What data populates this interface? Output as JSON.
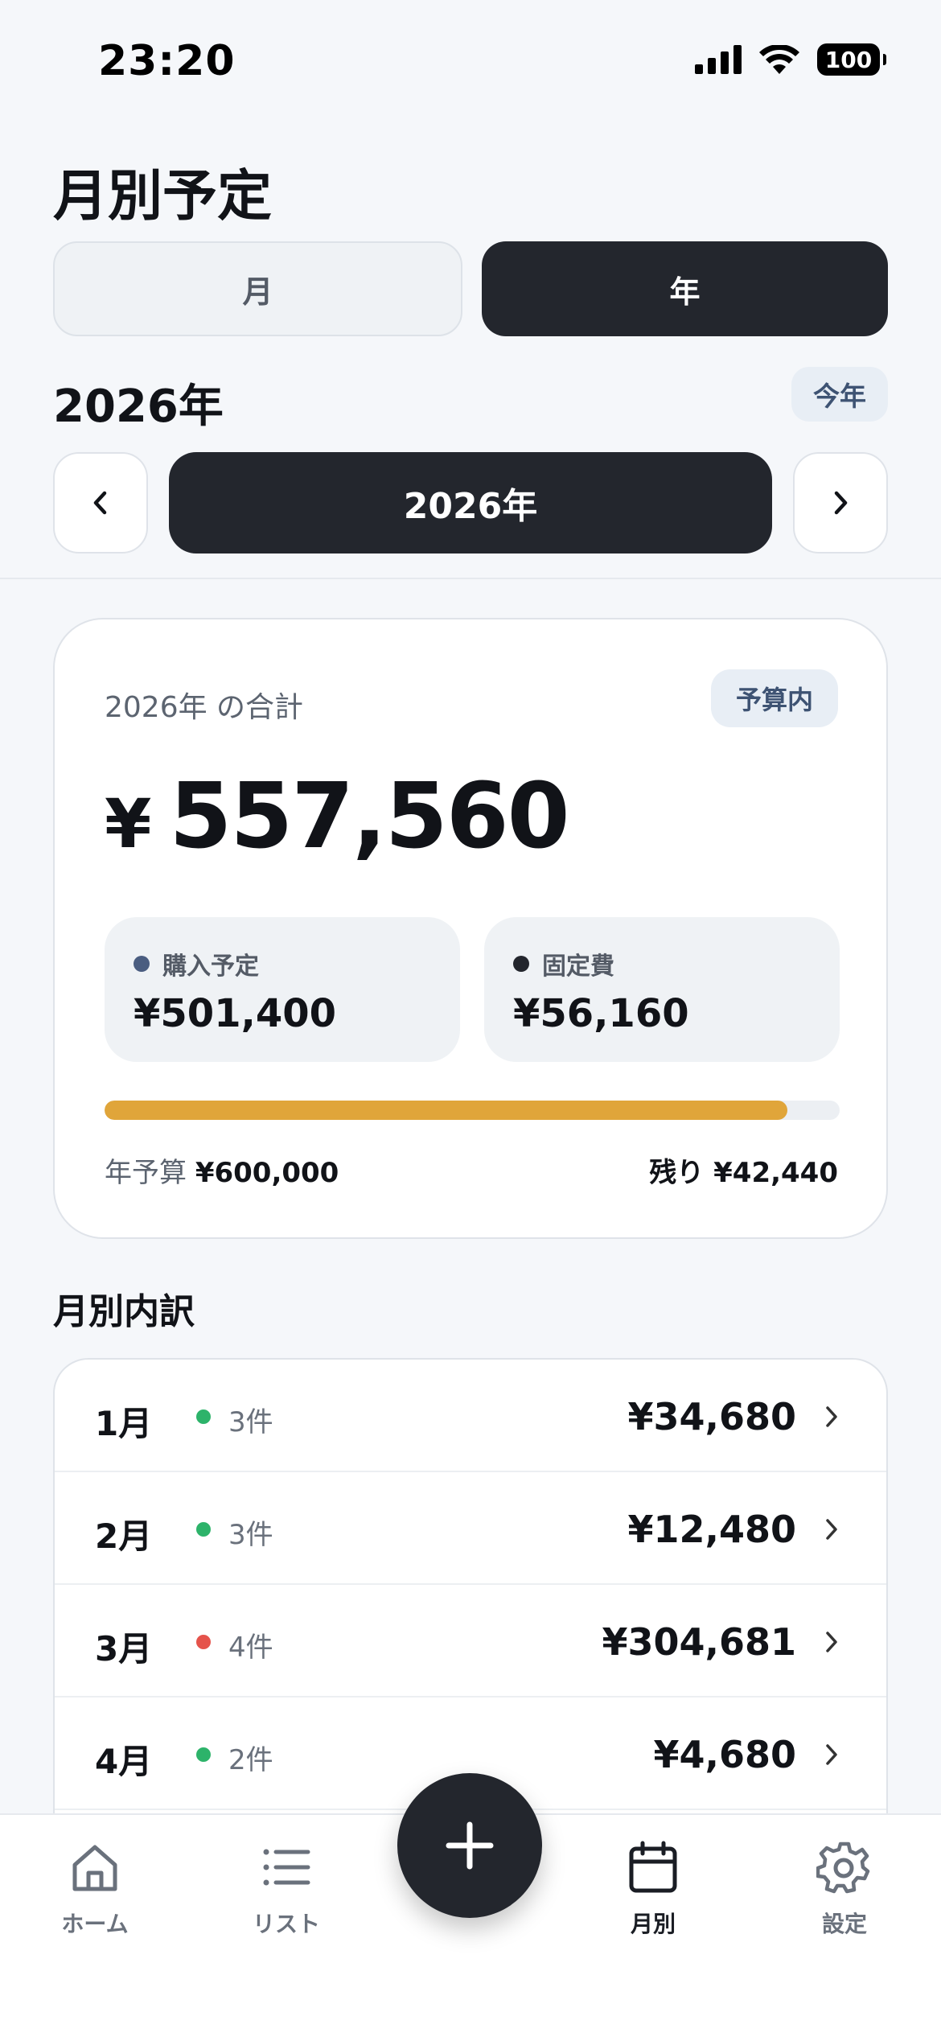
{
  "status": {
    "time": "23:20",
    "battery": "100"
  },
  "header": {
    "title": "月別予定"
  },
  "segment": {
    "month": "月",
    "year": "年"
  },
  "year_heading": "2026年",
  "this_year_button": "今年",
  "year_selector": "2026年",
  "summary": {
    "label": "2026年 の合計",
    "badge": "予算内",
    "currency": "¥",
    "total": "557,560",
    "purchase_label": "購入予定",
    "purchase_value": "¥501,400",
    "fixed_label": "固定費",
    "fixed_value": "¥56,160",
    "progress": 0.929,
    "budget_label": "年予算",
    "budget_value": "¥600,000",
    "remaining": "残り ¥42,440",
    "colors": {
      "purchase_dot": "#4a5d80",
      "fixed_dot": "#23262d",
      "progress": "#e0a53a"
    }
  },
  "monthly": {
    "title": "月別内訳",
    "rows": [
      {
        "month": "1月",
        "count": "3件",
        "amount": "¥34,680",
        "status_color": "#2db36a"
      },
      {
        "month": "2月",
        "count": "3件",
        "amount": "¥12,480",
        "status_color": "#2db36a"
      },
      {
        "month": "3月",
        "count": "4件",
        "amount": "¥304,681",
        "status_color": "#e5534b"
      },
      {
        "month": "4月",
        "count": "2件",
        "amount": "¥4,680",
        "status_color": "#2db36a"
      }
    ]
  },
  "tabs": [
    {
      "label": "ホーム",
      "icon": "home-icon"
    },
    {
      "label": "リスト",
      "icon": "list-icon"
    },
    {
      "label": "月別",
      "icon": "calendar-icon"
    },
    {
      "label": "設定",
      "icon": "gear-icon"
    }
  ],
  "fab": {
    "icon": "plus-icon"
  }
}
